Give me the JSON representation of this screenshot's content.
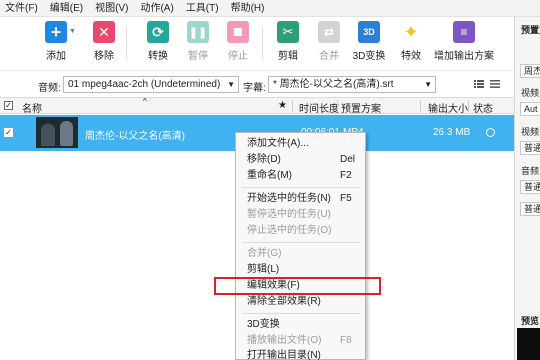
{
  "menubar": {
    "items": [
      "文件(F)",
      "编辑(E)",
      "视图(V)",
      "动作(A)",
      "工具(T)",
      "帮助(H)"
    ]
  },
  "toolbar": {
    "add": "添加",
    "remove": "移除",
    "convert": "转换",
    "pause": "暂停",
    "stop": "停止",
    "clip": "剪辑",
    "merge": "合并",
    "three_d": "3D变换",
    "effects": "特效",
    "add_profile": "增加输出方案",
    "three_d_icon_text": "3D"
  },
  "options": {
    "audio_label": "音频:",
    "audio_value": "01 mpeg4aac-2ch (Undetermined)",
    "subtitle_label": "字幕:",
    "subtitle_value": "* 周杰伦-以父之名(高清).srt"
  },
  "table": {
    "col_name": "名称",
    "col_star": "★",
    "col_duration": "时间长度",
    "col_profile": "预置方案",
    "col_size": "输出大小",
    "col_status": "状态"
  },
  "file_row": {
    "name": "周杰伦-以父之名(高清)",
    "duration": "00:06:01",
    "profile": "MP4",
    "size": "26.3 MB"
  },
  "context_menu": {
    "items": [
      {
        "label": "添加文件(A)...",
        "shortcut": "",
        "enabled": true
      },
      {
        "label": "移除(D)",
        "shortcut": "Del",
        "enabled": true
      },
      {
        "label": "重命名(M)",
        "shortcut": "F2",
        "enabled": true
      },
      {
        "label": "开始选中的任务(N)",
        "shortcut": "F5",
        "enabled": true
      },
      {
        "label": "暂停选中的任务(U)",
        "shortcut": "",
        "enabled": false
      },
      {
        "label": "停止选中的任务(O)",
        "shortcut": "",
        "enabled": false
      },
      {
        "label": "合并(G)",
        "shortcut": "",
        "enabled": false
      },
      {
        "label": "剪辑(L)",
        "shortcut": "",
        "enabled": true
      },
      {
        "label": "编辑效果(F)",
        "shortcut": "",
        "enabled": true
      },
      {
        "label": "清除全部效果(R)",
        "shortcut": "",
        "enabled": true
      },
      {
        "label": "3D变换",
        "shortcut": "",
        "enabled": true
      },
      {
        "label": "播放输出文件(O)",
        "shortcut": "F8",
        "enabled": false
      },
      {
        "label": "打开输出目录(N)",
        "shortcut": "",
        "enabled": true
      }
    ]
  },
  "right_panel": {
    "title": "预置方",
    "field1": "周杰",
    "label_video": "视频",
    "field_auto": "Aut",
    "label_video2": "视频",
    "field_normal": "普通",
    "label_audio": "音频",
    "field_normal2": "普通",
    "field_normal3": "普通",
    "preview_label": "预览"
  },
  "colors": {
    "selected_row": "#3fb2ef",
    "highlight_border": "#e02020",
    "add_icon": "#1e88e5",
    "remove_icon": "#e64a6e",
    "convert_icon": "#26a69a",
    "pause_icon": "#26a69a",
    "stop_icon": "#e91e63",
    "clip_icon": "#2e9e74",
    "merge_icon": "#a0a0a0",
    "three_d_icon": "#2b7fd4",
    "effects_icon": "#f6c026",
    "profile_icon": "#7e57c2"
  }
}
